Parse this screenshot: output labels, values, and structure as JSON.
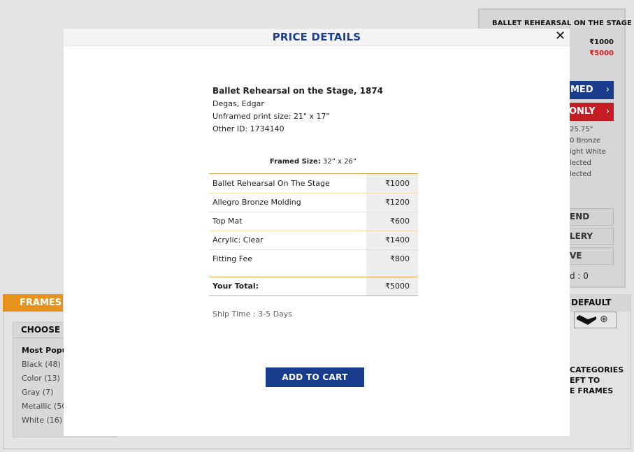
{
  "background": {
    "right_panel": {
      "title": "BALLET REHEARSAL ON THE STAGE",
      "price": "₹1000",
      "sale_price": "₹5000",
      "framed_button": "MED",
      "only_button": "ONLY",
      "chevron": "›",
      "specs": [
        "25.75\"",
        "0 Bronze",
        "ight White",
        "lected",
        "lected"
      ],
      "buttons": [
        "END",
        "LERY",
        "VE"
      ],
      "count": "d : 0"
    },
    "frames_tab": "FRAMES",
    "choose_label": "CHOOSE B",
    "filters": [
      "Most Popul",
      "Black (48)",
      "Color (13)",
      "Gray (7)",
      "Metallic (50",
      "White (16)"
    ],
    "default_label": "DEFAULT",
    "zoom_icon": "⊕",
    "categories_text": [
      "CATEGORIES",
      "EFT TO",
      "E FRAMES"
    ]
  },
  "modal": {
    "title": "PRICE DETAILS",
    "close": "✕",
    "artwork": {
      "title": "Ballet Rehearsal on the Stage, 1874",
      "artist": "Degas, Edgar",
      "print_size": "Unframed print size: 21\" x 17\"",
      "other_id": "Other ID: 1734140"
    },
    "framed_size_label": "Framed Size:",
    "framed_size_value": "32” x 26”",
    "items": [
      {
        "name": "Ballet Rehearsal On The Stage",
        "price": "₹1000"
      },
      {
        "name": "Allegro Bronze Molding",
        "price": "₹1200"
      },
      {
        "name": "Top Mat",
        "price": "₹600"
      },
      {
        "name": "Acrylic: Clear",
        "price": "₹1400"
      },
      {
        "name": "Fitting Fee",
        "price": "₹800"
      }
    ],
    "total_label": "Your Total:",
    "total_value": "₹5000",
    "ship_time": "Ship Time : 3-5 Days",
    "add_to_cart": "ADD TO CART"
  }
}
